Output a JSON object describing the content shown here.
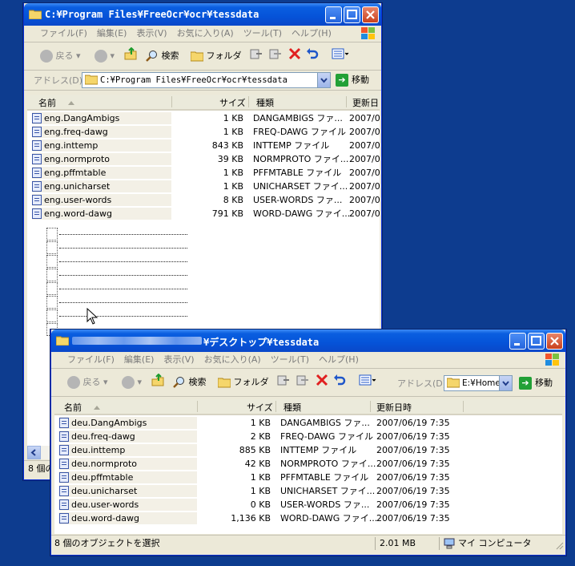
{
  "back_window": {
    "title": "C:¥Program Files¥FreeOcr¥ocr¥tessdata",
    "menu": [
      "ファイル(F)",
      "編集(E)",
      "表示(V)",
      "お気に入り(A)",
      "ツール(T)",
      "ヘルプ(H)"
    ],
    "toolbar": {
      "back": "戻る",
      "search": "検索",
      "folder": "フォルダ"
    },
    "address_label": "アドレス(D)",
    "address_value": "C:¥Program Files¥FreeOcr¥ocr¥tessdata",
    "go_label": "移動",
    "columns": {
      "name": "名前",
      "size": "サイズ",
      "type": "種類",
      "date": "更新日"
    },
    "files": [
      {
        "name": "eng.DangAmbigs",
        "size": "1 KB",
        "type": "DANGAMBIGS ファ...",
        "date": "2007/0"
      },
      {
        "name": "eng.freq-dawg",
        "size": "1 KB",
        "type": "FREQ-DAWG ファイル",
        "date": "2007/0"
      },
      {
        "name": "eng.inttemp",
        "size": "843 KB",
        "type": "INTTEMP ファイル",
        "date": "2007/0"
      },
      {
        "name": "eng.normproto",
        "size": "39 KB",
        "type": "NORMPROTO ファイ...",
        "date": "2007/0"
      },
      {
        "name": "eng.pffmtable",
        "size": "1 KB",
        "type": "PFFMTABLE ファイル",
        "date": "2007/0"
      },
      {
        "name": "eng.unicharset",
        "size": "1 KB",
        "type": "UNICHARSET ファイ...",
        "date": "2007/0"
      },
      {
        "name": "eng.user-words",
        "size": "8 KB",
        "type": "USER-WORDS ファ...",
        "date": "2007/0"
      },
      {
        "name": "eng.word-dawg",
        "size": "791 KB",
        "type": "WORD-DAWG ファイ...",
        "date": "2007/0"
      }
    ],
    "status": "8 個の"
  },
  "front_window": {
    "title_visible": "¥デスクトップ¥tessdata",
    "menu": [
      "ファイル(F)",
      "編集(E)",
      "表示(V)",
      "お気に入り(A)",
      "ツール(T)",
      "ヘルプ(H)"
    ],
    "toolbar": {
      "back": "戻る",
      "search": "検索",
      "folder": "フォルダ"
    },
    "address_label": "アドレス(D)",
    "address_value": "E:¥Home¥",
    "go_label": "移動",
    "columns": {
      "name": "名前",
      "size": "サイズ",
      "type": "種類",
      "date": "更新日時"
    },
    "files": [
      {
        "name": "deu.DangAmbigs",
        "size": "1 KB",
        "type": "DANGAMBIGS ファ...",
        "date": "2007/06/19 7:35"
      },
      {
        "name": "deu.freq-dawg",
        "size": "2 KB",
        "type": "FREQ-DAWG ファイル",
        "date": "2007/06/19 7:35"
      },
      {
        "name": "deu.inttemp",
        "size": "885 KB",
        "type": "INTTEMP ファイル",
        "date": "2007/06/19 7:35"
      },
      {
        "name": "deu.normproto",
        "size": "42 KB",
        "type": "NORMPROTO ファイ...",
        "date": "2007/06/19 7:35"
      },
      {
        "name": "deu.pffmtable",
        "size": "1 KB",
        "type": "PFFMTABLE ファイル",
        "date": "2007/06/19 7:35"
      },
      {
        "name": "deu.unicharset",
        "size": "1 KB",
        "type": "UNICHARSET ファイ...",
        "date": "2007/06/19 7:35"
      },
      {
        "name": "deu.user-words",
        "size": "0 KB",
        "type": "USER-WORDS ファ...",
        "date": "2007/06/19 7:35"
      },
      {
        "name": "deu.word-dawg",
        "size": "1,136 KB",
        "type": "WORD-DAWG ファイ...",
        "date": "2007/06/19 7:35"
      }
    ],
    "status_left": "8 個のオブジェクトを選択",
    "status_size": "2.01 MB",
    "status_location": "マイ コンピュータ"
  },
  "colors": {
    "desktop": "#0d3c8f",
    "titlebar": "#0553d8",
    "chrome": "#ece9d8"
  }
}
